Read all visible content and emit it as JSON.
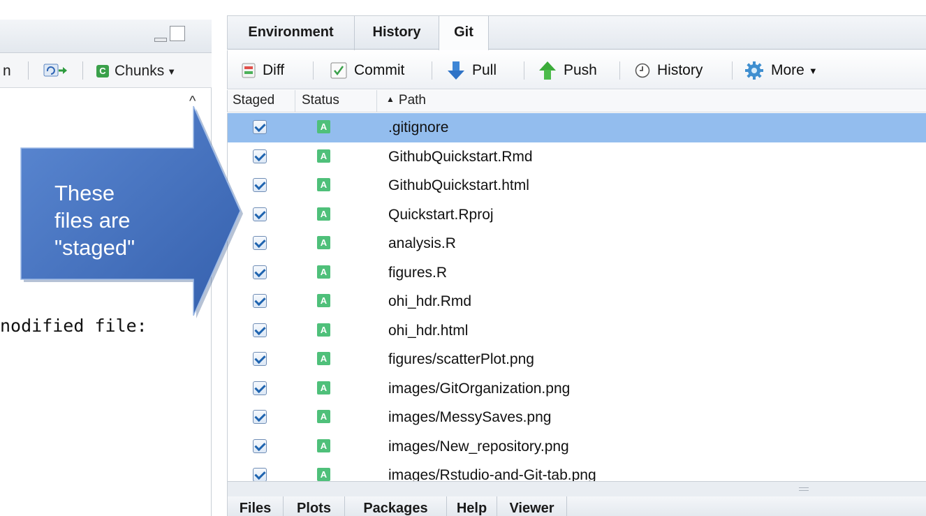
{
  "left_pane": {
    "toolbar": {
      "cut_label": "n",
      "chunks_label": "Chunks",
      "chunks_icon_letter": "C"
    },
    "console_text": "nodified file:"
  },
  "right_pane": {
    "tabs": [
      {
        "label": "Environment"
      },
      {
        "label": "History"
      },
      {
        "label": "Git"
      }
    ],
    "active_tab": "Git",
    "toolbar": {
      "diff": "Diff",
      "commit": "Commit",
      "pull": "Pull",
      "push": "Push",
      "history": "History",
      "more": "More"
    },
    "columns": {
      "staged": "Staged",
      "status": "Status",
      "path": "Path",
      "sort_indicator": "▲"
    },
    "files": [
      {
        "path": ".gitignore",
        "status": "A",
        "staged": true,
        "selected": true
      },
      {
        "path": "GithubQuickstart.Rmd",
        "status": "A",
        "staged": true
      },
      {
        "path": "GithubQuickstart.html",
        "status": "A",
        "staged": true
      },
      {
        "path": "Quickstart.Rproj",
        "status": "A",
        "staged": true
      },
      {
        "path": "analysis.R",
        "status": "A",
        "staged": true
      },
      {
        "path": "figures.R",
        "status": "A",
        "staged": true
      },
      {
        "path": "ohi_hdr.Rmd",
        "status": "A",
        "staged": true
      },
      {
        "path": "ohi_hdr.html",
        "status": "A",
        "staged": true
      },
      {
        "path": "figures/scatterPlot.png",
        "status": "A",
        "staged": true
      },
      {
        "path": "images/GitOrganization.png",
        "status": "A",
        "staged": true
      },
      {
        "path": "images/MessySaves.png",
        "status": "A",
        "staged": true
      },
      {
        "path": "images/New_repository.png",
        "status": "A",
        "staged": true
      },
      {
        "path": "images/Rstudio-and-Git-tab.png",
        "status": "A",
        "staged": true
      }
    ],
    "bottom_tabs": [
      {
        "label": "Files"
      },
      {
        "label": "Plots"
      },
      {
        "label": "Packages"
      },
      {
        "label": "Help"
      },
      {
        "label": "Viewer"
      }
    ]
  },
  "callout": {
    "lines": [
      "These",
      "files are",
      "\"staged\""
    ],
    "color": "#3f6fbf"
  }
}
